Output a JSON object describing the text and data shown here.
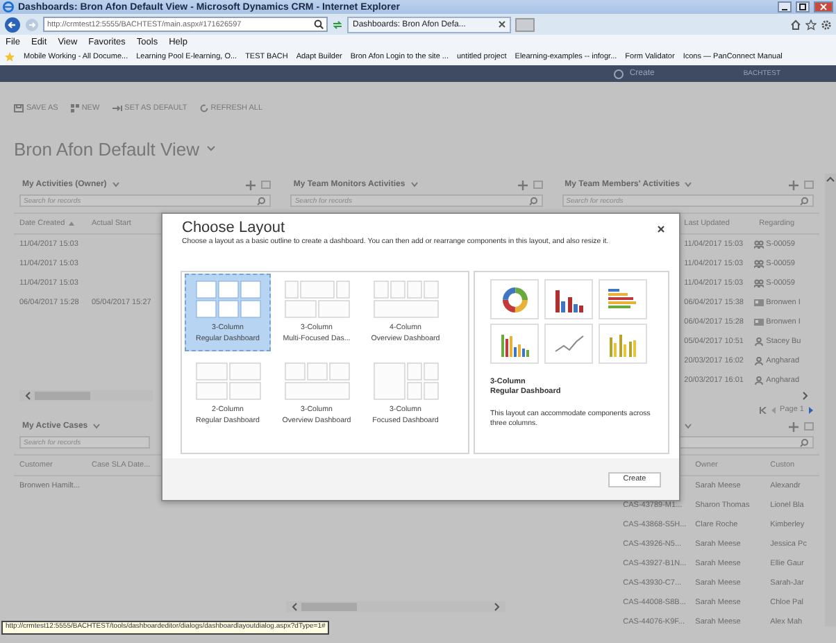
{
  "window": {
    "title": "Dashboards: Bron Afon Default View - Microsoft Dynamics CRM - Internet Explorer"
  },
  "browser": {
    "address": "http://crmtest12:5555/BACHTEST/main.aspx#171626597",
    "tab": "Dashboards: Bron Afon Defa...",
    "menu": [
      "File",
      "Edit",
      "View",
      "Favorites",
      "Tools",
      "Help"
    ],
    "favorites": [
      "Mobile Working - All Docume...",
      "Learning Pool E-learning, O...",
      "TEST BACH",
      "Adapt Builder",
      "Bron Afon Login to the site ...",
      "untitled project",
      "Elearning-examples -- infogr...",
      "Form Validator",
      "Icons — PanConnect Manual"
    ]
  },
  "crm_nav": {
    "create": "Create",
    "org": "BACHTEST"
  },
  "commands": [
    {
      "label": "SAVE AS",
      "kind": "save"
    },
    {
      "label": "NEW",
      "kind": "new"
    },
    {
      "label": "SET AS DEFAULT",
      "kind": "pin"
    },
    {
      "label": "REFRESH ALL",
      "kind": "refresh"
    }
  ],
  "dashboard": {
    "title": "Bron Afon Default View"
  },
  "activities_panel": {
    "title": "My Activities (Owner)",
    "search_placeholder": "Search for records",
    "columns": [
      {
        "label": "Date Created",
        "sorted": true
      },
      {
        "label": "Actual Start",
        "sorted": false
      }
    ],
    "rows": [
      {
        "date_created": "11/04/2017 15:03"
      },
      {
        "date_created": "11/04/2017 15:03"
      },
      {
        "date_created": "11/04/2017 15:03"
      },
      {
        "date_created": "06/04/2017 15:28",
        "actual_start": "05/04/2017 15:27"
      }
    ]
  },
  "team_monitors_panel": {
    "title": "My Team Monitors Activities",
    "search_placeholder": "Search for records"
  },
  "team_members_panel": {
    "title": "My Team Members' Activities",
    "search_placeholder": "Search for records",
    "columns": [
      "Last Updated",
      "Regarding"
    ],
    "rows": [
      {
        "last_updated": "11/04/2017 15:03",
        "regarding": "S-00059",
        "kind": "group"
      },
      {
        "last_updated": "11/04/2017 15:03",
        "regarding": "S-00059",
        "kind": "group"
      },
      {
        "last_updated": "11/04/2017 15:03",
        "regarding": "S-00059",
        "kind": "group"
      },
      {
        "last_updated": "06/04/2017 15:38",
        "regarding": "Bronwen I",
        "kind": "card"
      },
      {
        "last_updated": "06/04/2017 15:28",
        "regarding": "Bronwen I",
        "kind": "card"
      },
      {
        "last_updated": "05/04/2017 10:51",
        "regarding": "Stacey Bu",
        "kind": "person"
      },
      {
        "last_updated": "20/03/2017 16:02",
        "regarding": "Angharad",
        "kind": "person"
      },
      {
        "last_updated": "20/03/2017 16:01",
        "regarding": "Angharad",
        "kind": "person"
      }
    ],
    "pager": "Page 1"
  },
  "cases_panel": {
    "title": "My Active Cases",
    "search_placeholder": "Search for records",
    "columns": [
      "Customer",
      "Case SLA Date..."
    ],
    "rows": [
      {
        "customer": "Bronwen Hamilt..."
      }
    ]
  },
  "cases_right_panel": {
    "columns": [
      "Owner",
      "Custon"
    ],
    "rows": [
      {
        "owner": "Sarah Meese",
        "customer": "Alexandr"
      },
      {
        "case": "CAS-43789-M1...",
        "owner": "Sharon Thomas",
        "customer": "Lionel Bla"
      },
      {
        "case": "CAS-43868-S5H...",
        "owner": "Clare Roche",
        "customer": "Kimberley"
      },
      {
        "case": "CAS-43926-N5...",
        "owner": "Sarah Meese",
        "customer": "Jessica Pc"
      },
      {
        "case": "CAS-43927-B1N...",
        "owner": "Sarah Meese",
        "customer": "Ellie Gaur"
      },
      {
        "case": "CAS-43930-C7...",
        "owner": "Sarah Meese",
        "customer": "Sarah-Jar"
      },
      {
        "case": "CAS-44008-S8B...",
        "owner": "Sarah Meese",
        "customer": "Chloe Pal"
      },
      {
        "case": "CAS-44076-K9F...",
        "owner": "Sarah Meese",
        "customer": "Alex Mah"
      }
    ]
  },
  "dialog": {
    "title": "Choose Layout",
    "description": "Choose a layout as a basic outline to create a dashboard. You can then add or rearrange components in this layout, and also resize it.",
    "layouts": [
      {
        "lines": [
          "3-Column",
          "Regular Dashboard"
        ],
        "kind": "three-regular",
        "selected": true
      },
      {
        "lines": [
          "3-Column",
          "Multi-Focused Das..."
        ],
        "kind": "three-multi-focused",
        "selected": false
      },
      {
        "lines": [
          "4-Column",
          "Overview Dashboard"
        ],
        "kind": "four-overview",
        "selected": false
      },
      {
        "lines": [
          "2-Column",
          "Regular Dashboard"
        ],
        "kind": "two-regular",
        "selected": false
      },
      {
        "lines": [
          "3-Column",
          "Overview Dashboard"
        ],
        "kind": "three-overview",
        "selected": false
      },
      {
        "lines": [
          "3-Column",
          "Focused Dashboard"
        ],
        "kind": "three-focused",
        "selected": false
      }
    ],
    "preview": {
      "charts": [
        {
          "kind": "donut"
        },
        {
          "kind": "column-red"
        },
        {
          "kind": "bar-horizontal"
        },
        {
          "kind": "column-multi"
        },
        {
          "kind": "line"
        },
        {
          "kind": "column-yellow"
        }
      ],
      "title": [
        "3-Column",
        "Regular Dashboard"
      ],
      "description": "This layout can accommodate components across three columns."
    },
    "button": "Create"
  },
  "status_bar": {
    "url": "http://crmtest12:5555/BACHTEST/tools/dashboardeditor/dialogs/dashboardlayoutdialog.aspx?dType=1#"
  }
}
